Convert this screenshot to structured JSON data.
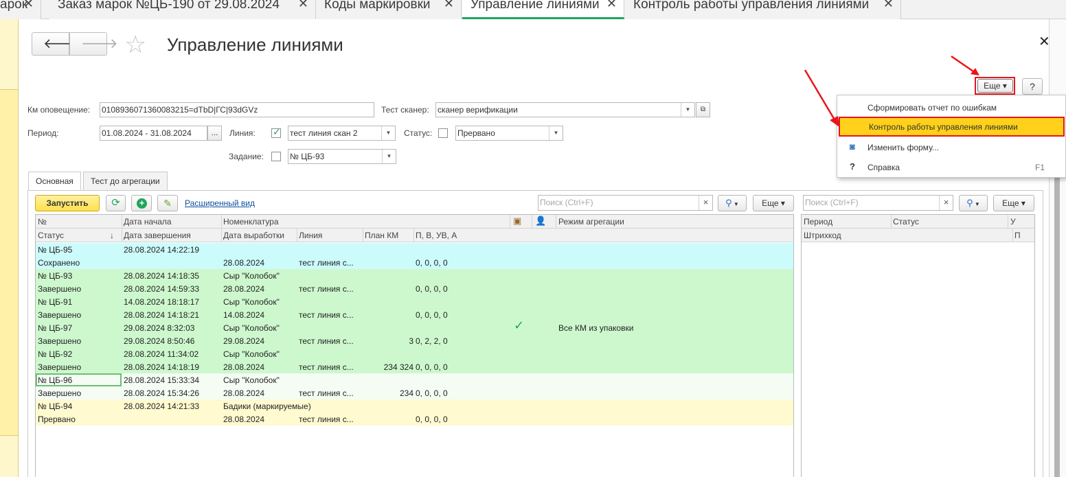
{
  "tabs": [
    {
      "label": "арок"
    },
    {
      "label": "Заказ марок №ЦБ-190 от 29.08.2024"
    },
    {
      "label": "Коды маркировки"
    },
    {
      "label": "Управление линиями"
    },
    {
      "label": "Контроль работы управления линиями"
    }
  ],
  "header": {
    "title": "Управление линиями",
    "back": "🡐",
    "forward": "🡒",
    "star": "☆",
    "close": "✕"
  },
  "toolbar_top": {
    "more": "Еще ▾",
    "help": "?"
  },
  "filters": {
    "km_label": "Км оповещение:",
    "km_value": "0108936071360083215=dTbD|ГС|93dGVz",
    "scanner_label": "Тест сканер:",
    "scanner_value": "сканер верификации",
    "period_label": "Период:",
    "period_value": "01.08.2024 - 31.08.2024",
    "period_btn": "...",
    "line_label": "Линия:",
    "line_value": "тест линия скан 2",
    "status_label": "Статус:",
    "status_value": "Прервано",
    "task_label": "Задание:",
    "task_value": "№ ЦБ-93"
  },
  "inner_tabs": [
    {
      "label": "Основная"
    },
    {
      "label": "Тест до агрегации"
    }
  ],
  "grid_toolbar": {
    "start": "Запустить",
    "extended": "Расширенный вид",
    "search_placeholder": "Поиск (Ctrl+F)",
    "search_clear": "×",
    "more": "Еще ▾"
  },
  "grid_header": {
    "r1": {
      "num": "№",
      "start": "Дата начала",
      "nom": "Номенклатура",
      "mode": "Режим агрегации"
    },
    "r2": {
      "status": "Статус",
      "sort": "↓",
      "end": "Дата завершения",
      "made": "Дата выработки",
      "line": "Линия",
      "plan": "План КМ",
      "pvua": "П, В, УВ, А"
    }
  },
  "rows": [
    {
      "num": "№ ЦБ-95",
      "start": "28.08.2024 14:22:19",
      "nom": "",
      "mode": "",
      "check": "",
      "status": "Сохранено",
      "end": "",
      "made": "28.08.2024",
      "line": "тест линия с...",
      "plan": "",
      "pvua": "0, 0, 0, 0",
      "color": "#ccfbfb"
    },
    {
      "num": "№ ЦБ-93",
      "start": "28.08.2024 14:18:35",
      "nom": "Сыр \"Колобок\"",
      "mode": "",
      "check": "",
      "status": "Завершено",
      "end": "28.08.2024 14:59:33",
      "made": "28.08.2024",
      "line": "тест линия с...",
      "plan": "",
      "pvua": "0, 0, 0, 0",
      "color": "#cdf8cd"
    },
    {
      "num": "№ ЦБ-91",
      "start": "14.08.2024 18:18:17",
      "nom": "Сыр \"Колобок\"",
      "mode": "",
      "check": "",
      "status": "Завершено",
      "end": "28.08.2024 14:18:21",
      "made": "14.08.2024",
      "line": "тест линия с...",
      "plan": "",
      "pvua": "0, 0, 0, 0",
      "color": "#cdf8cd"
    },
    {
      "num": "№ ЦБ-97",
      "start": "29.08.2024 8:32:03",
      "nom": "Сыр \"Колобок\"",
      "mode": "Все КМ из упаковки",
      "check": "✓",
      "status": "Завершено",
      "end": "29.08.2024 8:50:46",
      "made": "29.08.2024",
      "line": "тест линия с...",
      "plan": "3",
      "pvua": "0, 2, 2, 0",
      "color": "#cdf8cd"
    },
    {
      "num": "№ ЦБ-92",
      "start": "28.08.2024 11:34:02",
      "nom": "Сыр \"Колобок\"",
      "mode": "",
      "check": "",
      "status": "Завершено",
      "end": "28.08.2024 14:18:19",
      "made": "28.08.2024",
      "line": "тест линия с...",
      "plan": "234 324",
      "pvua": "0, 0, 0, 0",
      "color": "#cdf8cd"
    },
    {
      "num": "№ ЦБ-96",
      "start": "28.08.2024 15:33:34",
      "nom": "Сыр \"Колобок\"",
      "mode": "",
      "check": "",
      "status": "Завершено",
      "end": "28.08.2024 15:34:26",
      "made": "28.08.2024",
      "line": "тест линия с...",
      "plan": "234",
      "pvua": "0, 0, 0, 0",
      "color": "#f4fcf4"
    },
    {
      "num": "№ ЦБ-94",
      "start": "28.08.2024 14:21:33",
      "nom": "Бадики (маркируемые)",
      "mode": "",
      "check": "",
      "status": "Прервано",
      "end": "",
      "made": "28.08.2024",
      "line": "тест линия с...",
      "plan": "",
      "pvua": "0, 0, 0, 0",
      "color": "#fffad0"
    }
  ],
  "right_grid": {
    "r1": {
      "period": "Период",
      "status": "Статус",
      "u": "У"
    },
    "r2": {
      "barcode": "Штрихкод",
      "p": "П"
    }
  },
  "menu": {
    "items": [
      {
        "label": "Сформировать отчет по ошибкам",
        "icon": "",
        "shortcut": ""
      },
      {
        "label": "Контроль работы управления линиями",
        "icon": "",
        "shortcut": ""
      },
      {
        "label": "Изменить форму...",
        "icon": "◙",
        "shortcut": ""
      },
      {
        "label": "Справка",
        "icon": "?",
        "shortcut": "F1"
      }
    ]
  },
  "colors": {
    "accent": "#1fa55a",
    "highlight": "#ffd11a",
    "annotation": "#e8151b",
    "start_btn": "#ffe566"
  }
}
